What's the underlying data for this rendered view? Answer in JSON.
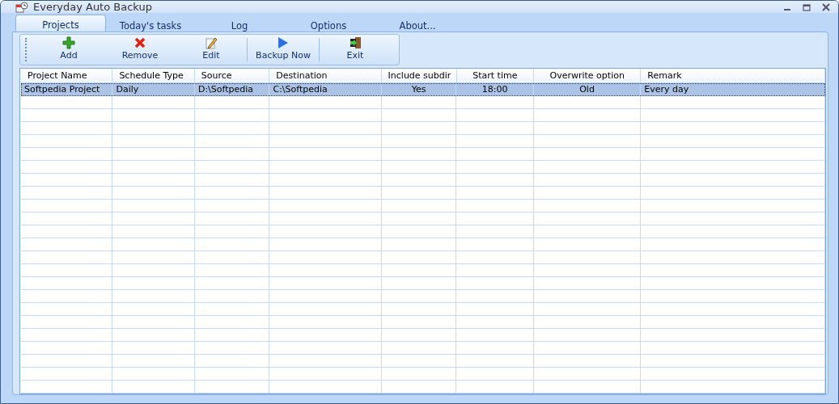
{
  "window": {
    "title": "Everyday Auto Backup"
  },
  "tabs": [
    {
      "label": "Projects",
      "selected": true
    },
    {
      "label": "Today's tasks",
      "selected": false
    },
    {
      "label": "Log",
      "selected": false
    },
    {
      "label": "Options",
      "selected": false
    },
    {
      "label": "About...",
      "selected": false
    }
  ],
  "toolbar": [
    "Add",
    "Remove",
    "Edit",
    "Backup Now",
    "Exit"
  ],
  "table": {
    "columns": [
      "Project Name",
      "Schedule Type",
      "Source",
      "Destination",
      "Include subdir",
      "Start time",
      "Overwrite option",
      "Remark"
    ],
    "rows": [
      {
        "selected": true,
        "cells": [
          "Softpedia Project",
          "Daily",
          "D:\\Softpedia",
          "C:\\Softpedia",
          "Yes",
          "18:00",
          "Old",
          "Every day"
        ]
      }
    ]
  }
}
